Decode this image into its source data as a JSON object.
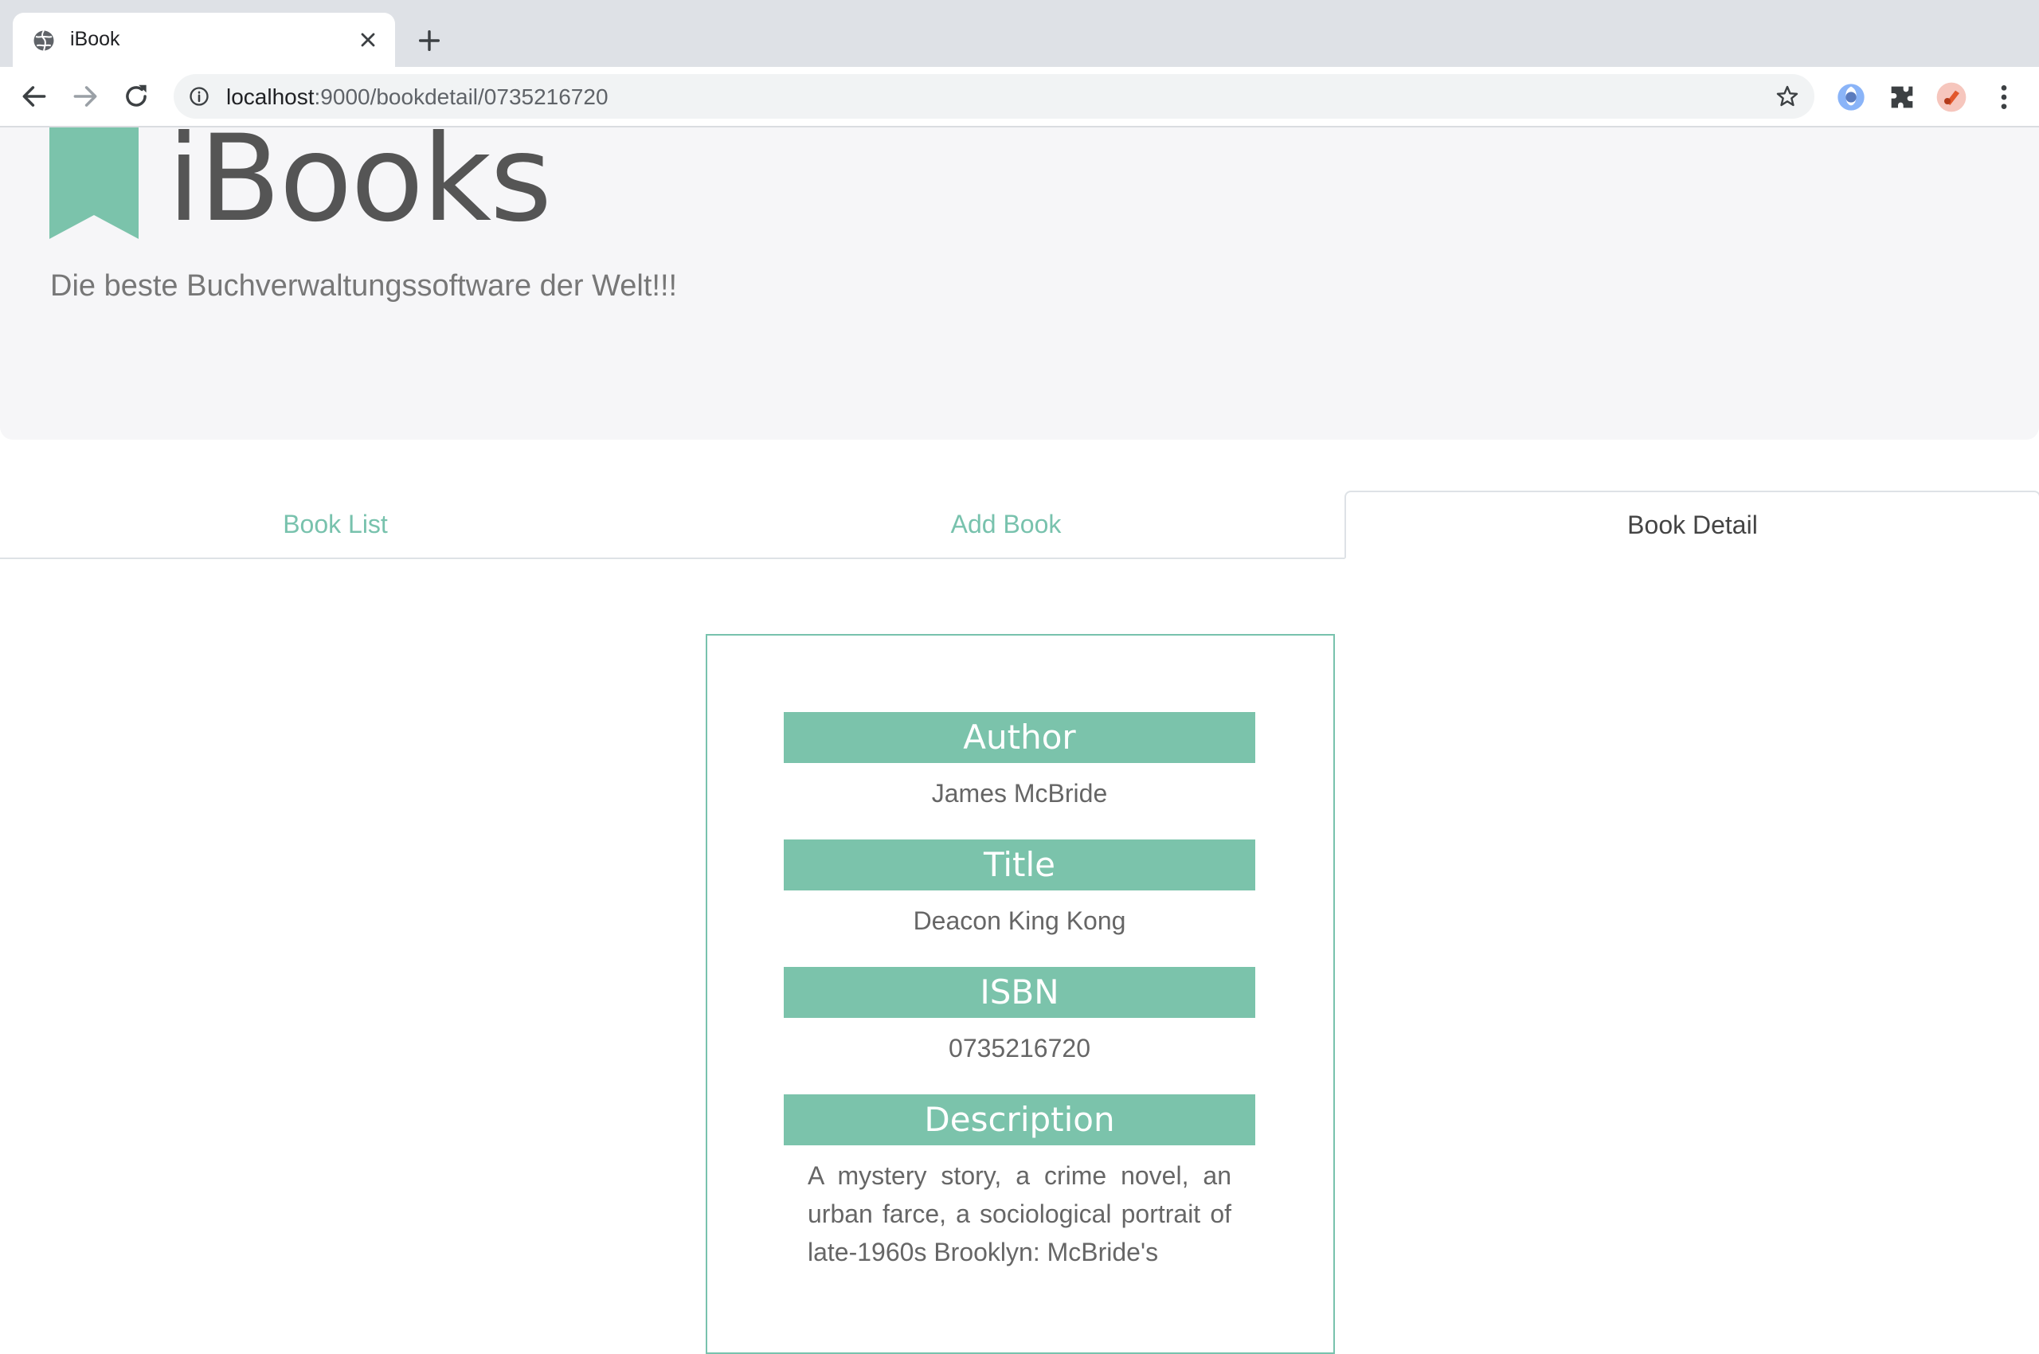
{
  "browser": {
    "tab_title": "iBook",
    "url_host": "localhost",
    "url_path": ":9000/bookdetail/0735216720"
  },
  "header": {
    "brand": "iBooks",
    "tagline": "Die beste Buchverwaltungssoftware der Welt!!!"
  },
  "nav": {
    "tabs": [
      {
        "label": "Book List"
      },
      {
        "label": "Add Book"
      },
      {
        "label": "Book Detail"
      }
    ]
  },
  "book": {
    "author_label": "Author",
    "author": "James McBride",
    "title_label": "Title",
    "title": "Deacon King Kong",
    "isbn_label": "ISBN",
    "isbn": "0735216720",
    "description_label": "Description",
    "description": "A mystery story, a crime novel, an urban farce, a sociological portrait of late-1960s Brooklyn: McBride's"
  },
  "colors": {
    "accent": "#78c2ad",
    "header_bg": "#7bc3ab",
    "jumbotron_bg": "#f6f6f8"
  }
}
